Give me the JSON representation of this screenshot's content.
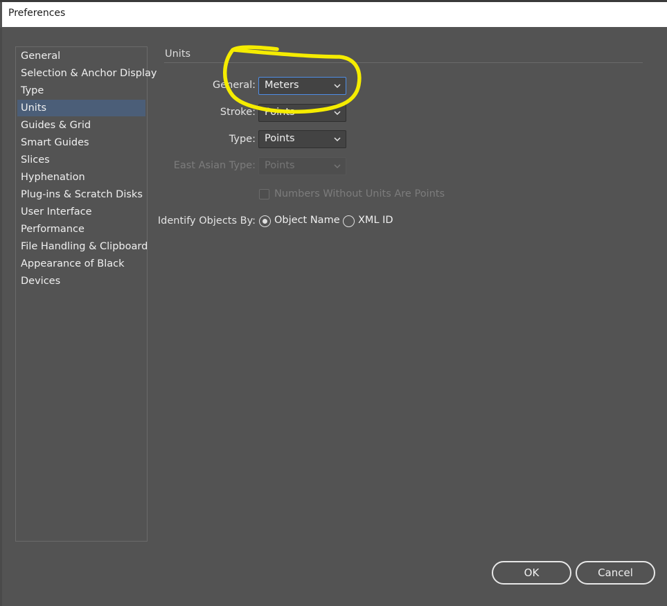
{
  "window": {
    "title": "Preferences"
  },
  "sidebar": {
    "items": [
      {
        "label": "General"
      },
      {
        "label": "Selection & Anchor Display"
      },
      {
        "label": "Type"
      },
      {
        "label": "Units"
      },
      {
        "label": "Guides & Grid"
      },
      {
        "label": "Smart Guides"
      },
      {
        "label": "Slices"
      },
      {
        "label": "Hyphenation"
      },
      {
        "label": "Plug-ins & Scratch Disks"
      },
      {
        "label": "User Interface"
      },
      {
        "label": "Performance"
      },
      {
        "label": "File Handling & Clipboard"
      },
      {
        "label": "Appearance of Black"
      },
      {
        "label": "Devices"
      }
    ],
    "selected": "Units"
  },
  "units": {
    "section_title": "Units",
    "general": {
      "label": "General:",
      "value": "Meters"
    },
    "stroke": {
      "label": "Stroke:",
      "value": "Points"
    },
    "type": {
      "label": "Type:",
      "value": "Points"
    },
    "east_asian_type": {
      "label": "East Asian Type:",
      "value": "Points",
      "disabled": true
    },
    "numbers_without_units": {
      "label": "Numbers Without Units Are Points",
      "checked": false,
      "disabled": true
    },
    "identify_objects": {
      "label": "Identify Objects By:",
      "options": [
        {
          "label": "Object Name",
          "checked": true
        },
        {
          "label": "XML ID",
          "checked": false
        }
      ]
    }
  },
  "buttons": {
    "ok": "OK",
    "cancel": "Cancel"
  },
  "colors": {
    "background": "#535353",
    "selection": "#4b5e78",
    "focus_border": "#4f8ee6",
    "annotation": "#f5ec00"
  },
  "icons": {
    "dropdown": "chevron-down-icon",
    "annotation": "freehand-circle-annotation"
  }
}
